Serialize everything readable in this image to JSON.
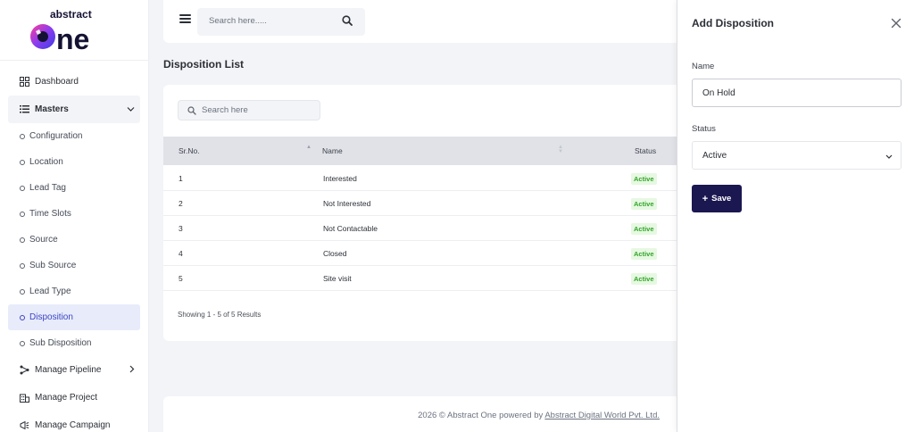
{
  "brand": {
    "top": "abstract",
    "bottom": "One"
  },
  "sidebar": {
    "items": [
      {
        "label": "Dashboard",
        "icon": "grid-icon"
      },
      {
        "label": "Masters",
        "icon": "list-icon"
      },
      {
        "label": "Configuration",
        "icon": "circle-icon"
      },
      {
        "label": "Location",
        "icon": "circle-icon"
      },
      {
        "label": "Lead Tag",
        "icon": "circle-icon"
      },
      {
        "label": "Time Slots",
        "icon": "circle-icon"
      },
      {
        "label": "Source",
        "icon": "circle-icon"
      },
      {
        "label": "Sub Source",
        "icon": "circle-icon"
      },
      {
        "label": "Lead Type",
        "icon": "circle-icon"
      },
      {
        "label": "Disposition",
        "icon": "circle-icon"
      },
      {
        "label": "Sub Disposition",
        "icon": "circle-icon"
      },
      {
        "label": "Manage Pipeline",
        "icon": "pipeline-icon"
      },
      {
        "label": "Manage Project",
        "icon": "building-icon"
      },
      {
        "label": "Manage Campaign",
        "icon": "megaphone-icon"
      }
    ]
  },
  "topbar": {
    "search_placeholder": "Search here....."
  },
  "page": {
    "title": "Disposition List"
  },
  "list": {
    "search_placeholder": "Search here",
    "columns": {
      "srno": "Sr.No.",
      "name": "Name",
      "status": "Status"
    },
    "rows": [
      {
        "srno": "1",
        "name": "Interested",
        "status": "Active"
      },
      {
        "srno": "2",
        "name": "Not Interested",
        "status": "Active"
      },
      {
        "srno": "3",
        "name": "Not Contactable",
        "status": "Active"
      },
      {
        "srno": "4",
        "name": "Closed",
        "status": "Active"
      },
      {
        "srno": "5",
        "name": "Site visit",
        "status": "Active"
      }
    ],
    "showing": "Showing 1 - 5 of 5 Results"
  },
  "footer": {
    "text": "2026 © Abstract One powered by ",
    "link": "Abstract Digital World Pvt. Ltd."
  },
  "drawer": {
    "title": "Add Disposition",
    "name_label": "Name",
    "name_value": "On Hold",
    "status_label": "Status",
    "status_value": "Active",
    "save_label": "Save"
  },
  "colors": {
    "accent": "#1b1750",
    "active_nav": "#3b46c4",
    "badge_bg": "#e6f8e1",
    "badge_text": "#33a52b"
  }
}
